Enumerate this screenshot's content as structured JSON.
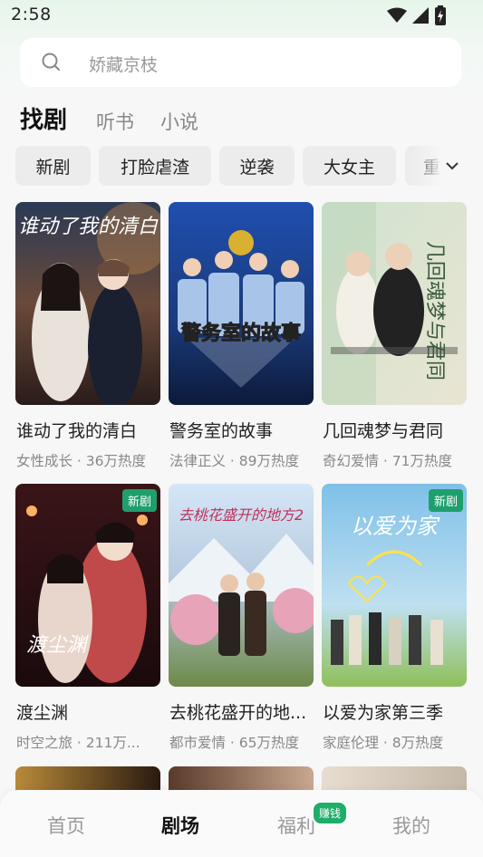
{
  "status_bar": {
    "time": "2:58"
  },
  "search": {
    "placeholder": "娇藏京枝"
  },
  "main_tabs": [
    {
      "label": "找剧",
      "active": true
    },
    {
      "label": "听书",
      "active": false
    },
    {
      "label": "小说",
      "active": false
    }
  ],
  "chips": [
    "新剧",
    "打脸虐渣",
    "逆袭",
    "大女主",
    "重"
  ],
  "cards": [
    {
      "title": "谁动了我的清白",
      "meta": "女性成长 · 36万热度",
      "poster_text": "谁动了我的清白",
      "new_badge": ""
    },
    {
      "title": "警务室的故事",
      "meta": "法律正义 · 89万热度",
      "poster_text": "警务室的故事",
      "new_badge": ""
    },
    {
      "title": "几回魂梦与君同",
      "meta": "奇幻爱情 · 71万热度",
      "poster_text": "几回魂梦与君同",
      "new_badge": ""
    },
    {
      "title": "渡尘渊",
      "meta": "时空之旅 · 211万...",
      "poster_text": "渡尘渊",
      "new_badge": "新剧"
    },
    {
      "title": "去桃花盛开的地...",
      "meta": "都市爱情 · 65万热度",
      "poster_text": "去桃花盛开的地方2",
      "new_badge": ""
    },
    {
      "title": "以爱为家第三季",
      "meta": "家庭伦理 · 8万热度",
      "poster_text": "以爱为家",
      "new_badge": "新剧"
    }
  ],
  "bottom_nav": {
    "items": [
      {
        "label": "首页",
        "active": false
      },
      {
        "label": "剧场",
        "active": true
      },
      {
        "label": "福利",
        "active": false
      },
      {
        "label": "我的",
        "active": false
      }
    ],
    "earn_badge": "赚钱"
  },
  "colors": {
    "accent_green": "#1f9f6e",
    "badge_green": "#1fae6a"
  }
}
